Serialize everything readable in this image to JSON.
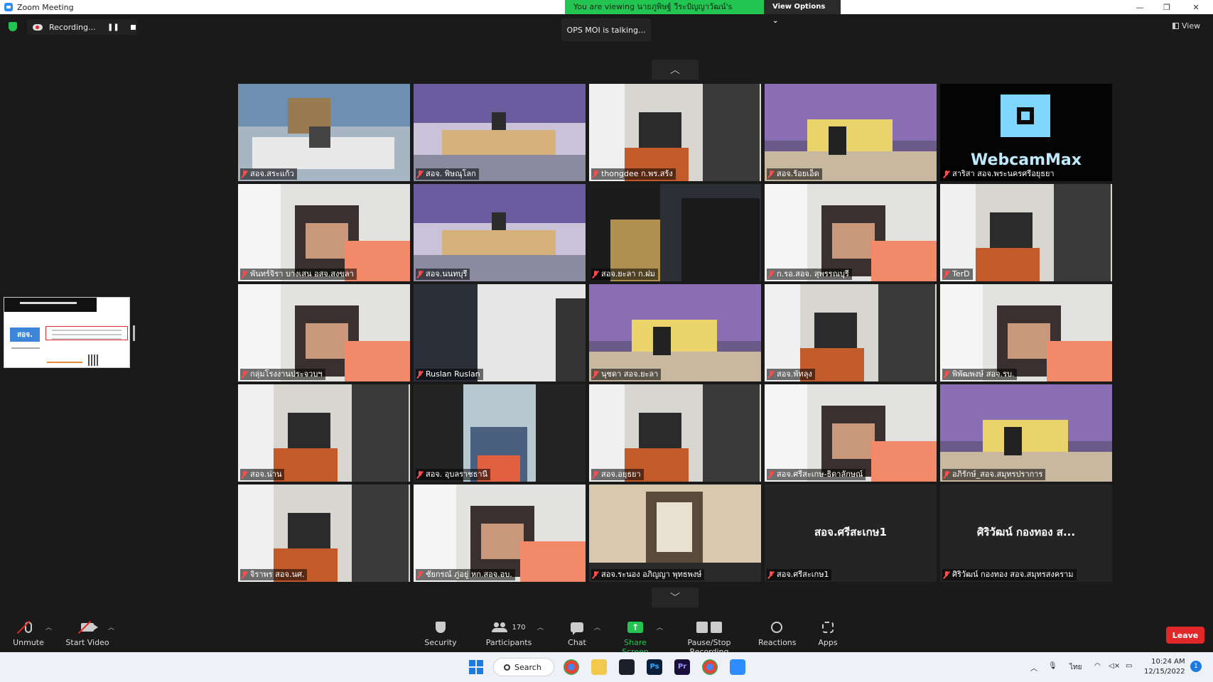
{
  "window": {
    "title": "Zoom Meeting",
    "share_banner": "You are viewing นายภูพิษฐ์ วีระปัญญาวัฒน์'s screen",
    "view_options": "View Options",
    "controls": [
      "—",
      "❐",
      "✕"
    ]
  },
  "overlay": {
    "recording": "Recording...",
    "talking": "OPS MOI is talking...",
    "view": "View"
  },
  "thumbnail": {
    "badge": "สอจ."
  },
  "participants": [
    {
      "name": "สอจ.สระแก้ว",
      "scene": "desk"
    },
    {
      "name": "สอจ. พิษณุโลก",
      "scene": "meeting"
    },
    {
      "name": "thongdee ก.พร.สร้ง",
      "scene": "office"
    },
    {
      "name": "สอจ.ร้อยเอ็ด",
      "scene": "poster"
    },
    {
      "name": "สาริสา สอจ.พระนครศรีอยุธยา",
      "scene": "webcam",
      "overlay_text": "WebcamMax"
    },
    {
      "name": "พันทร์จิรา บางเสน อสจ.สงขลา",
      "scene": "face"
    },
    {
      "name": "สอจ.นนทบุรี",
      "scene": "meeting"
    },
    {
      "name": "สอจ.ยะลา ก.ฝม",
      "scene": "dark"
    },
    {
      "name": "ก.รอ.สอจ. สุพรรณบุรี",
      "scene": "face"
    },
    {
      "name": "TerD",
      "scene": "office"
    },
    {
      "name": "กลุ่มโรงงานประจวบฯ",
      "scene": "face"
    },
    {
      "name": "Ruslan Ruslan",
      "scene": "blank"
    },
    {
      "name": "นุชดา สอจ.ยะลา",
      "scene": "poster"
    },
    {
      "name": "สอจ.พัทลุง",
      "scene": "office"
    },
    {
      "name": "พิพัฒพงษ์ สอจ.รบ.",
      "scene": "face"
    },
    {
      "name": "สอจ.น่าน",
      "scene": "office"
    },
    {
      "name": "สอจ. อุบลราชธานี",
      "scene": "narrow"
    },
    {
      "name": "สอจ.อยุธยา",
      "scene": "office"
    },
    {
      "name": "สอจ.ศรีสะเกษ-ธิดาลักษณ์",
      "scene": "face"
    },
    {
      "name": "อภิรักษ์_สอจ.สมุทรปราการ",
      "scene": "poster"
    },
    {
      "name": "จิราพร สอจ.นศ.",
      "scene": "office"
    },
    {
      "name": "ชัยกรณ์ ภู่อยู่ หก.สอจ.อบ.",
      "scene": "face"
    },
    {
      "name": "สอจ.ระนอง อภิญญา พุทธพงษ์",
      "scene": "portrait"
    },
    {
      "name": "สอจ.ศรีสะเกษ1",
      "scene": "name",
      "display_name": "สอจ.ศรีสะเกษ1"
    },
    {
      "name": "ศิริวัฒน์ กองทอง สอจ.สมุทรสงคราม",
      "scene": "name",
      "display_name": "ศิริวัฒน์ กองทอง ส..."
    }
  ],
  "toolbar": {
    "unmute": "Unmute",
    "start_video": "Start Video",
    "security": "Security",
    "participants": "Participants",
    "participant_count": "170",
    "chat": "Chat",
    "share_screen": "Share Screen",
    "pause_stop": "Pause/Stop Recording",
    "reactions": "Reactions",
    "apps": "Apps",
    "leave": "Leave"
  },
  "taskbar": {
    "search": "Search",
    "lang": "ไทย",
    "time": "10:24 AM",
    "date": "12/15/2022",
    "notifications": "1"
  }
}
